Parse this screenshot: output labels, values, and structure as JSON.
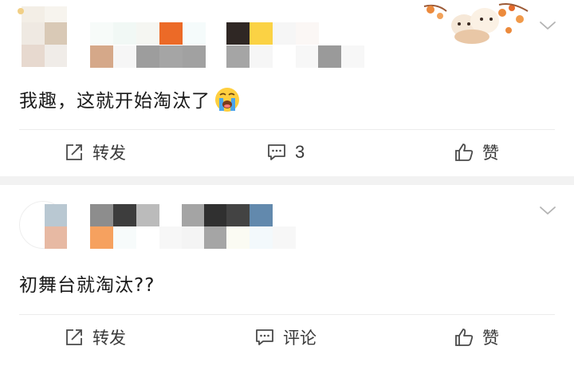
{
  "posts": [
    {
      "content": "我趣，这就开始淘汰了",
      "emoji": "crying-face-emoji",
      "actions": {
        "repost_label": "转发",
        "comment_label": "3",
        "like_label": "赞"
      }
    },
    {
      "content": "初舞台就淘汰??",
      "actions": {
        "repost_label": "转发",
        "comment_label": "评论",
        "like_label": "赞"
      }
    }
  ],
  "icons": {
    "repost": "repost-icon",
    "comment": "comment-icon",
    "like": "like-icon",
    "more": "chevron-down-icon"
  },
  "colors": {
    "divider": "#f2f2f2",
    "text": "#1a1a1a",
    "action_text": "#3a3a3a"
  }
}
